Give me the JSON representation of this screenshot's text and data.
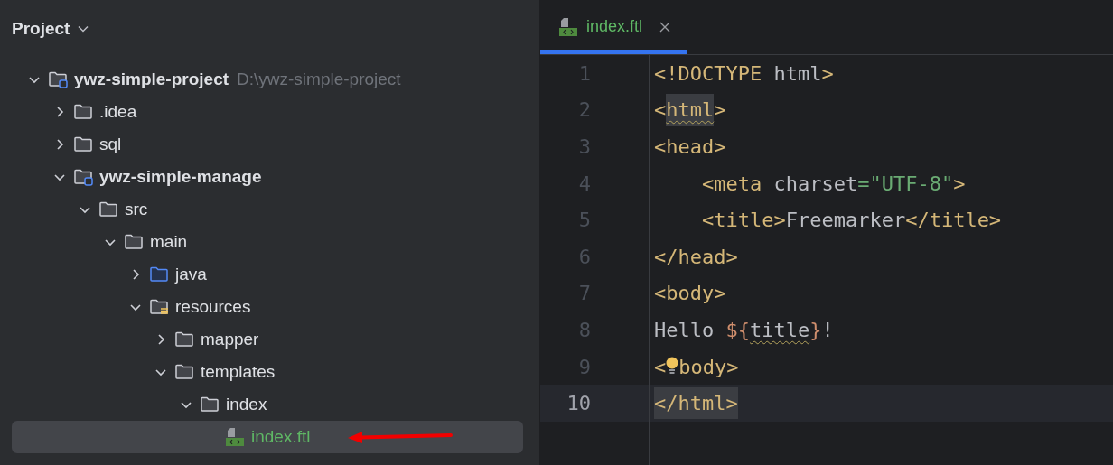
{
  "project_panel": {
    "title": "Project",
    "tree": [
      {
        "label": "ywz-simple-project",
        "kind": "module",
        "hint": "D:\\ywz-simple-project",
        "expanded": true,
        "selected": false,
        "children": [
          {
            "label": ".idea",
            "kind": "folder",
            "expanded": false,
            "selected": false
          },
          {
            "label": "sql",
            "kind": "folder",
            "expanded": false,
            "selected": false
          },
          {
            "label": "ywz-simple-manage",
            "kind": "module",
            "expanded": true,
            "selected": false,
            "children": [
              {
                "label": "src",
                "kind": "folder",
                "expanded": true,
                "selected": false,
                "children": [
                  {
                    "label": "main",
                    "kind": "folder",
                    "expanded": true,
                    "selected": false,
                    "children": [
                      {
                        "label": "java",
                        "kind": "source-folder",
                        "expanded": false,
                        "selected": false
                      },
                      {
                        "label": "resources",
                        "kind": "resources-folder",
                        "expanded": true,
                        "selected": false,
                        "children": [
                          {
                            "label": "mapper",
                            "kind": "folder",
                            "expanded": false,
                            "selected": false
                          },
                          {
                            "label": "templates",
                            "kind": "folder",
                            "expanded": true,
                            "selected": false,
                            "children": [
                              {
                                "label": "index",
                                "kind": "folder",
                                "expanded": true,
                                "selected": false,
                                "children": [
                                  {
                                    "label": "index.ftl",
                                    "kind": "template-file",
                                    "selected": true
                                  }
                                ]
                              }
                            ]
                          }
                        ]
                      }
                    ]
                  }
                ]
              }
            ]
          }
        ]
      }
    ]
  },
  "editor": {
    "tabs": [
      {
        "label": "index.ftl",
        "selected": true
      }
    ],
    "lines": [
      {
        "number": "1",
        "current": false,
        "tokens": [
          {
            "kind": "tag",
            "text": "<!DOCTYPE"
          },
          {
            "kind": "text",
            "text": " html"
          },
          {
            "kind": "tag",
            "text": ">"
          }
        ]
      },
      {
        "number": "2",
        "current": false,
        "tokens": [
          {
            "kind": "tag",
            "text": "<"
          },
          {
            "kind": "tag",
            "text": "html",
            "warning": true,
            "highlight": true
          },
          {
            "kind": "tag",
            "text": ">"
          }
        ]
      },
      {
        "number": "3",
        "current": false,
        "tokens": [
          {
            "kind": "tag",
            "text": "<head>"
          }
        ]
      },
      {
        "number": "4",
        "current": false,
        "tokens": [
          {
            "kind": "indent"
          },
          {
            "kind": "tag",
            "text": "<meta"
          },
          {
            "kind": "text",
            "text": " charset"
          },
          {
            "kind": "string",
            "text": "=\"UTF-8\""
          },
          {
            "kind": "tag",
            "text": ">"
          }
        ]
      },
      {
        "number": "5",
        "current": false,
        "tokens": [
          {
            "kind": "indent"
          },
          {
            "kind": "tag",
            "text": "<title>"
          },
          {
            "kind": "text",
            "text": "Freemarker"
          },
          {
            "kind": "tag",
            "text": "</title>"
          }
        ]
      },
      {
        "number": "6",
        "current": false,
        "tokens": [
          {
            "kind": "tag",
            "text": "</head>"
          }
        ]
      },
      {
        "number": "7",
        "current": false,
        "tokens": [
          {
            "kind": "tag",
            "text": "<body>"
          }
        ]
      },
      {
        "number": "8",
        "current": false,
        "tokens": [
          {
            "kind": "text",
            "text": "Hello "
          },
          {
            "kind": "expr",
            "text": "${"
          },
          {
            "kind": "text",
            "text": "title",
            "warning": true
          },
          {
            "kind": "expr",
            "text": "}"
          },
          {
            "kind": "text",
            "text": "!"
          }
        ]
      },
      {
        "number": "9",
        "current": false,
        "tokens": [
          {
            "kind": "tag",
            "text": "<"
          },
          {
            "kind": "bulb"
          },
          {
            "kind": "tag",
            "text": "body>"
          }
        ]
      },
      {
        "number": "10",
        "current": true,
        "tokens": [
          {
            "kind": "tag",
            "text": "</html>",
            "highlight": true
          }
        ]
      }
    ]
  }
}
